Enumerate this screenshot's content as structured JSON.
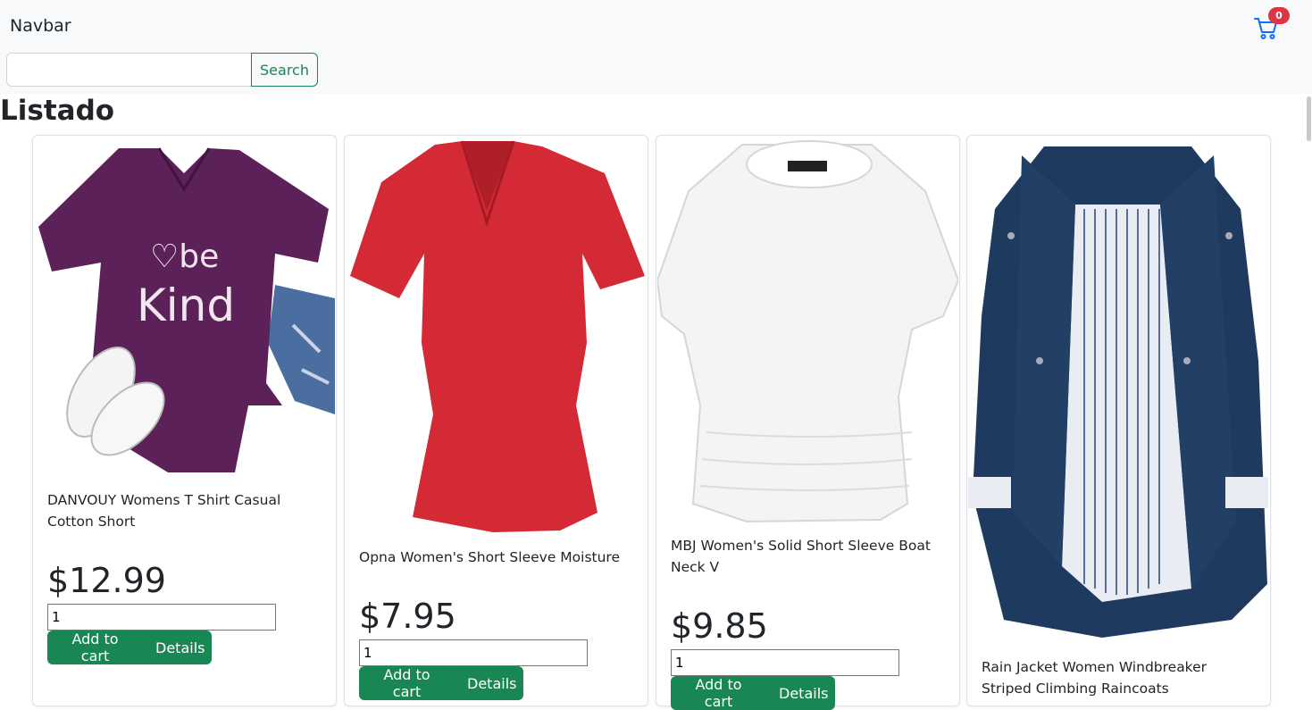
{
  "navbar": {
    "brand": "Navbar",
    "search_placeholder": "",
    "search_button": "Search",
    "cart_count": "0"
  },
  "page": {
    "title": "Listado"
  },
  "products": [
    {
      "title": "DANVOUY Womens T Shirt Casual Cotton Short",
      "price": "$12.99",
      "qty": "1",
      "add_label": "Add to cart",
      "details_label": "Details",
      "image": "purple-be-kind-tshirt-image"
    },
    {
      "title": "Opna Women's Short Sleeve Moisture",
      "price": "$7.95",
      "qty": "1",
      "add_label": "Add to cart",
      "details_label": "Details",
      "image": "red-vneck-tshirt-image"
    },
    {
      "title": "MBJ Women's Solid Short Sleeve Boat Neck V",
      "price": "$9.85",
      "qty": "1",
      "add_label": "Add to cart",
      "details_label": "Details",
      "image": "white-boat-neck-top-image"
    },
    {
      "title": "Rain Jacket Women Windbreaker Striped Climbing Raincoats",
      "price": "",
      "qty": "",
      "add_label": "",
      "details_label": "",
      "image": "navy-rain-jacket-image"
    }
  ],
  "colors": {
    "primary_green": "#198754",
    "badge_red": "#dc3545",
    "cart_blue": "#0d6efd",
    "navbar_bg": "#f8f9fa"
  }
}
